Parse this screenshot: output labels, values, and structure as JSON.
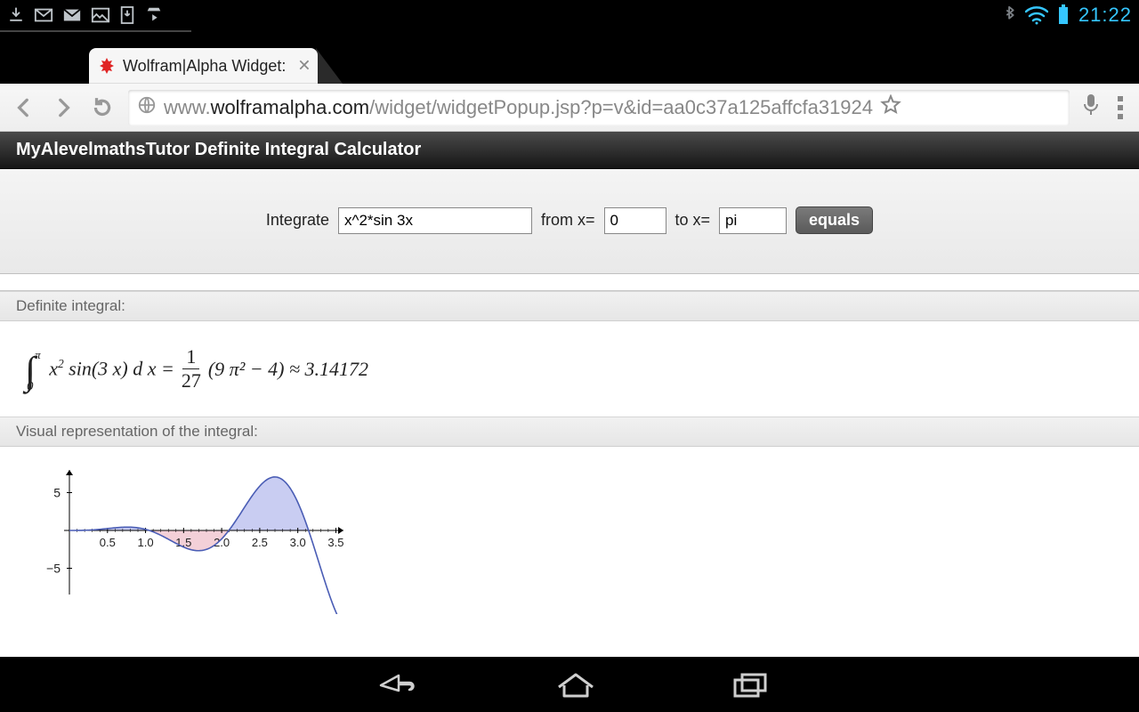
{
  "statusbar": {
    "clock": "21:22"
  },
  "tab": {
    "title": "Wolfram|Alpha Widget:"
  },
  "url": {
    "prefix": "www.",
    "domain": "wolframalpha.com",
    "path": "/widget/widgetPopup.jsp?p=v&id=aa0c37a125affcfa31924"
  },
  "widget": {
    "title": "MyAlevelmathsTutor Definite Integral Calculator",
    "label_integrate": "Integrate",
    "function_value": "x^2*sin 3x",
    "label_from": "from x=",
    "from_value": "0",
    "label_to": "to x=",
    "to_value": "pi",
    "equals_label": "equals"
  },
  "sections": {
    "definite_header": "Definite integral:",
    "visual_header": "Visual representation of the integral:"
  },
  "formula": {
    "upper": "π",
    "lower": "0",
    "integrand_lhs_a": "x",
    "integrand_lhs_exp": "2",
    "integrand_lhs_b": " sin(3 x) d x =",
    "frac_num": "1",
    "frac_den": "27",
    "rhs": "(9 π² − 4) ≈ 3.14172"
  },
  "chart_data": {
    "type": "area",
    "title": "",
    "xlabel": "",
    "ylabel": "",
    "xlim": [
      0,
      3.6
    ],
    "ylim": [
      -8,
      8
    ],
    "xticks": [
      0.5,
      1.0,
      1.5,
      2.0,
      2.5,
      3.0,
      3.5
    ],
    "yticks": [
      -5,
      5
    ],
    "series": [
      {
        "name": "x^2 sin(3x)",
        "x": [
          0.0,
          0.2,
          0.4,
          0.6,
          0.8,
          1.0,
          1.047,
          1.2,
          1.4,
          1.6,
          1.8,
          2.0,
          2.094,
          2.2,
          2.4,
          2.6,
          2.8,
          3.0,
          3.14,
          3.2,
          3.4,
          3.5
        ],
        "y": [
          0.0,
          0.023,
          0.149,
          0.351,
          0.434,
          0.141,
          0.0,
          -0.637,
          -1.705,
          -2.552,
          -2.495,
          -1.118,
          0.0,
          1.506,
          4.575,
          6.758,
          7.271,
          5.293,
          0.0,
          -1.787,
          -8.116,
          -11.03
        ]
      }
    ],
    "shade_between": {
      "series": 0,
      "from_x": 0,
      "to_x": 3.14159
    }
  }
}
